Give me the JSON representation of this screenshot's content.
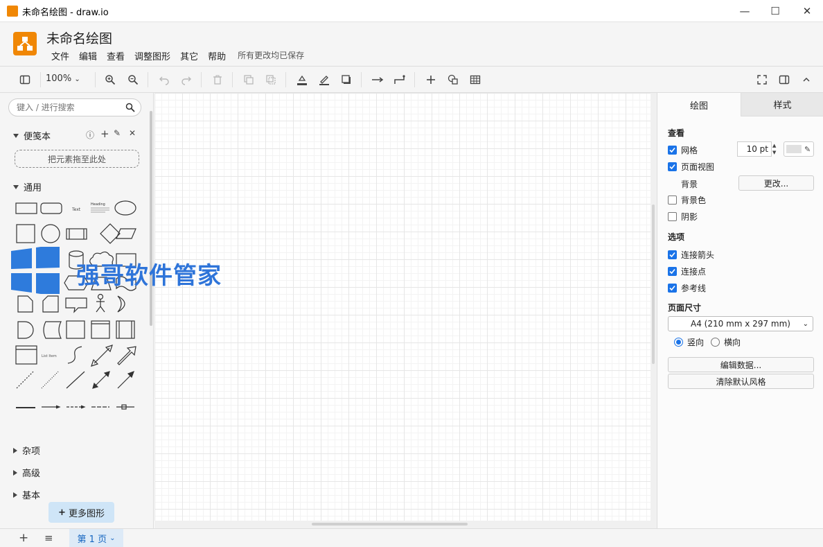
{
  "window": {
    "title": "未命名绘图 - draw.io",
    "minimize": "—",
    "maximize": "☐",
    "close": "✕"
  },
  "header": {
    "doc_title": "未命名绘图",
    "menu": [
      "文件",
      "编辑",
      "查看",
      "调整图形",
      "其它",
      "帮助"
    ],
    "save_status": "所有更改均已保存"
  },
  "toolbar": {
    "zoom": "100%"
  },
  "sidebar": {
    "search_placeholder": "键入 / 进行搜索",
    "scratchpad": {
      "title": "便笺本",
      "drop_hint": "把元素拖至此处"
    },
    "general": {
      "title": "通用"
    },
    "shape_labels": {
      "text": "Text",
      "heading": "Heading",
      "list": "List Item"
    },
    "collapsed_sections": [
      "杂项",
      "高级",
      "基本"
    ],
    "more_shapes": "更多图形"
  },
  "format_panel": {
    "tabs": {
      "diagram": "绘图",
      "style": "样式"
    },
    "view": {
      "heading": "查看",
      "grid": {
        "label": "网格",
        "checked": true,
        "size": "10 pt"
      },
      "page_view": {
        "label": "页面视图",
        "checked": true
      },
      "background": {
        "label": "背景",
        "button": "更改..."
      },
      "background_color": {
        "label": "背景色",
        "checked": false
      },
      "shadow": {
        "label": "阴影",
        "checked": false
      }
    },
    "options": {
      "heading": "选项",
      "connection_arrows": {
        "label": "连接箭头",
        "checked": true
      },
      "connection_points": {
        "label": "连接点",
        "checked": true
      },
      "guides": {
        "label": "参考线",
        "checked": true
      }
    },
    "paper_size": {
      "heading": "页面尺寸",
      "selected": "A4 (210 mm x 297 mm)",
      "portrait": "竖向",
      "landscape": "横向",
      "orientation": "portrait"
    },
    "edit_data": "编辑数据...",
    "clear_default_style": "清除默认风格"
  },
  "footer": {
    "page_tab": "第 1 页"
  },
  "watermark": {
    "text": "强哥软件管家"
  },
  "colors": {
    "accent": "#f08705",
    "checkbox": "#1a73e8",
    "page_tab": "#ddeaf7"
  }
}
